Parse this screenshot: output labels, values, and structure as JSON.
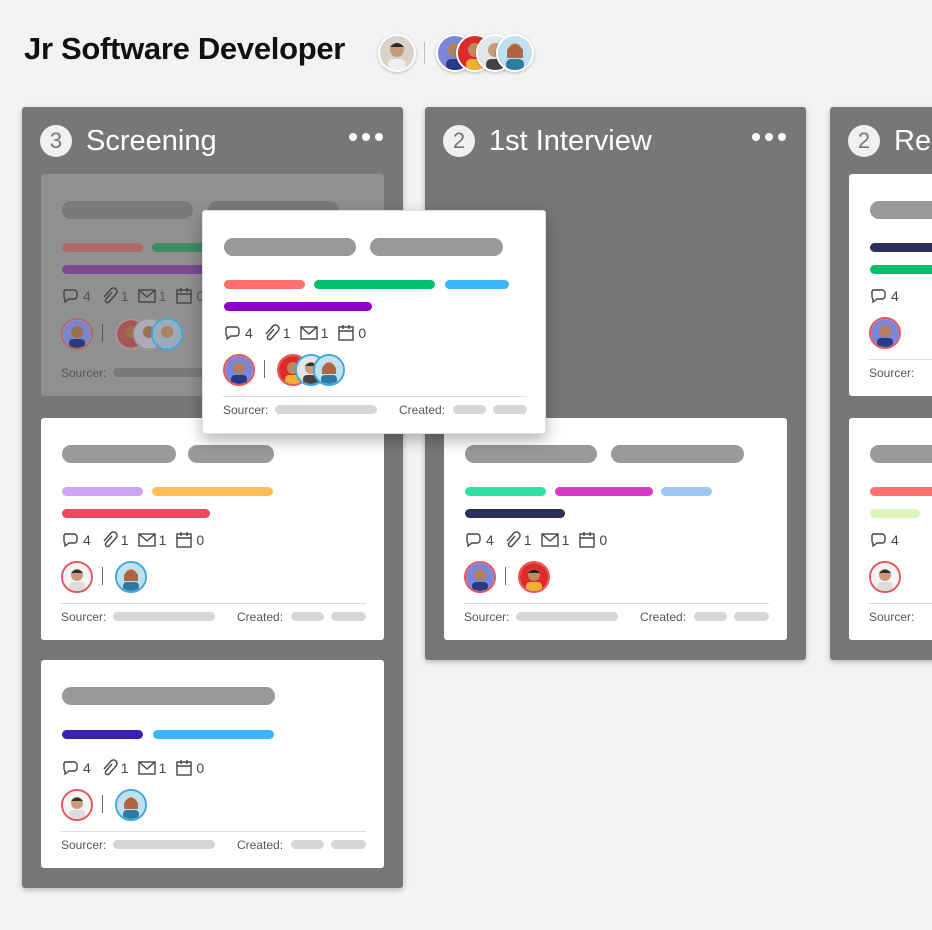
{
  "page": {
    "title": "Jr Software Developer"
  },
  "header_avatars": {
    "icons": [
      "person-avatar-icon",
      "person-avatar-icon",
      "person-avatar-icon",
      "person-avatar-icon",
      "person-avatar-icon"
    ]
  },
  "columns": [
    {
      "count": "3",
      "title": "Screening",
      "menu_icon": "more-horizontal-icon"
    },
    {
      "count": "2",
      "title": "1st Interview",
      "menu_icon": "more-horizontal-icon"
    },
    {
      "count": "2",
      "title": "Re",
      "menu_icon": "more-horizontal-icon"
    }
  ],
  "cards": [
    {
      "id": "screening-ghost",
      "comments": "4",
      "attachments": "1",
      "emails": "1",
      "events": "0",
      "sourcer_label": "Sourcer:",
      "created_label": "Created:"
    },
    {
      "id": "dragged",
      "comments": "4",
      "attachments": "1",
      "emails": "1",
      "events": "0",
      "sourcer_label": "Sourcer:",
      "created_label": "Created:"
    },
    {
      "id": "screening-2",
      "comments": "4",
      "attachments": "1",
      "emails": "1",
      "events": "0",
      "sourcer_label": "Sourcer:",
      "created_label": "Created:"
    },
    {
      "id": "screening-3",
      "comments": "4",
      "attachments": "1",
      "emails": "1",
      "events": "0",
      "sourcer_label": "Sourcer:",
      "created_label": "Created:"
    },
    {
      "id": "interview-1",
      "comments": "4",
      "attachments": "1",
      "emails": "1",
      "events": "0",
      "sourcer_label": "Sourcer:",
      "created_label": "Created:"
    },
    {
      "id": "re-1",
      "comments": "4",
      "sourcer_label": "Sourcer:"
    },
    {
      "id": "re-2",
      "comments": "4",
      "sourcer_label": "Sourcer:"
    }
  ],
  "colors": {
    "column_bg": "#777777",
    "tag_salmon": "#ff6f6f",
    "tag_green": "#00c16a",
    "tag_sky": "#3ab6ff",
    "tag_purple": "#8e00c8",
    "tag_lilac": "#cfa3f5",
    "tag_orange": "#ffbe55",
    "tag_red": "#e84a5f",
    "tag_indigo": "#3a1fb5",
    "tag_teal": "#2ee0a5",
    "tag_magenta": "#d63ac8",
    "tag_lightblue": "#9cc8f5",
    "tag_navy": "#2b2f5a"
  }
}
